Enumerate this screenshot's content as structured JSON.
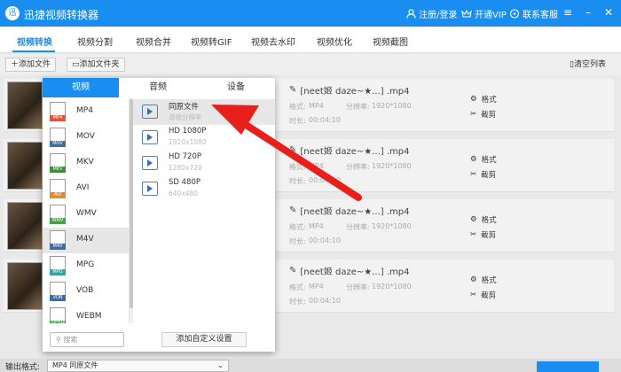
{
  "app": {
    "title": "迅捷视频转换器",
    "logo": "迅",
    "login": "注册/登录",
    "vip": "开通VIP",
    "service": "联系客服"
  },
  "tabs": [
    "视频转换",
    "视频分割",
    "视频合并",
    "视频转GIF",
    "视频去水印",
    "视频优化",
    "视频截图"
  ],
  "toolbar": {
    "add_file": "添加文件",
    "add_folder": "添加文件夹",
    "clear_list": "清空列表"
  },
  "files": [
    {
      "name": "[neet姬 daze~★...] .mp4",
      "format_label": "格式:",
      "format": "MP4",
      "res_label": "分辨率:",
      "res": "1920*1080",
      "dur_label": "时长:",
      "dur": "00:04:10",
      "fmt_btn": "格式",
      "cut_btn": "截剪"
    },
    {
      "name": "[neet姬 daze~★...] .mp4",
      "format_label": "格式:",
      "format": "MP4",
      "res_label": "分辨率:",
      "res": "1920*1080",
      "dur_label": "时长:",
      "dur": "00:04:10",
      "fmt_btn": "格式",
      "cut_btn": "截剪"
    },
    {
      "name": "[neet姬 daze~★...] .mp4",
      "format_label": "格式:",
      "format": "MP4",
      "res_label": "分辨率:",
      "res": "1920*1080",
      "dur_label": "时长:",
      "dur": "00:04:10",
      "fmt_btn": "格式",
      "cut_btn": "截剪"
    },
    {
      "name": "[neet姬 daze~★...] .mp4",
      "format_label": "格式:",
      "format": "MP4",
      "res_label": "分辨率:",
      "res": "1920*1080",
      "dur_label": "时长:",
      "dur": "00:04:10",
      "fmt_btn": "格式",
      "cut_btn": "截剪"
    }
  ],
  "popup": {
    "tabs": [
      "视频",
      "音频",
      "设备"
    ],
    "formats": [
      {
        "label": "MP4",
        "color": "#e0533d"
      },
      {
        "label": "MOV",
        "color": "#3b6ea8"
      },
      {
        "label": "MKV",
        "color": "#3a8f3a"
      },
      {
        "label": "AVI",
        "color": "#e68a2e"
      },
      {
        "label": "WMV",
        "color": "#4aa04a"
      },
      {
        "label": "M4V",
        "color": "#3b6ea8"
      },
      {
        "label": "MPG",
        "color": "#3aa0a0"
      },
      {
        "label": "VOB",
        "color": "#3b6ea8"
      },
      {
        "label": "WEBM",
        "color": "#3a8f3a"
      }
    ],
    "qualities": [
      {
        "name": "同原文件",
        "sub": "源视分辨率"
      },
      {
        "name": "HD 1080P",
        "sub": "1920x1080"
      },
      {
        "name": "HD 720P",
        "sub": "1280x720"
      },
      {
        "name": "SD 480P",
        "sub": "640x480"
      }
    ],
    "search_placeholder": "搜索",
    "custom_btn": "添加自定义设置"
  },
  "output": {
    "label": "输出格式:",
    "value": "MP4 同原文件"
  },
  "colors": {
    "brand": "#1a8ef0",
    "arrow": "#e8201c"
  }
}
